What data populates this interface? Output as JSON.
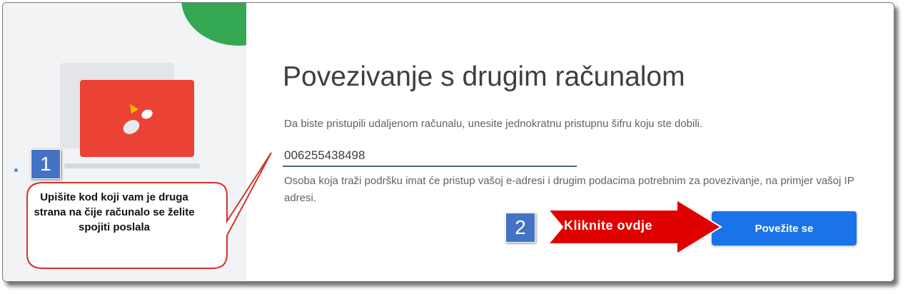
{
  "dialog": {
    "title": "Povezivanje s drugim računalom",
    "description": "Da biste pristupili udaljenom računalu, unesite jednokratnu pristupnu šifru koju ste dobili.",
    "access_code": "006255438498",
    "notice": "Osoba koja traži podršku imat će pristup vašoj e-adresi i drugim podacima potrebnim za povezivanje, na primjer vašoj IP adresi.",
    "connect_label": "Povežite se"
  },
  "annotations": {
    "step1": "1",
    "step1_callout": "Upišite kod koji vam je druga strana na čije računalo se želite spojiti poslala",
    "step2": "2",
    "step2_arrow": "Kliknite ovdje"
  },
  "colors": {
    "accent_blue": "#1a73e8",
    "logo_red": "#ea4335",
    "logo_green": "#34a853",
    "badge_blue": "#4472c4",
    "arrow_red": "#e00000"
  },
  "icons": {
    "app_logo": "chrome-remote-desktop-icon"
  }
}
